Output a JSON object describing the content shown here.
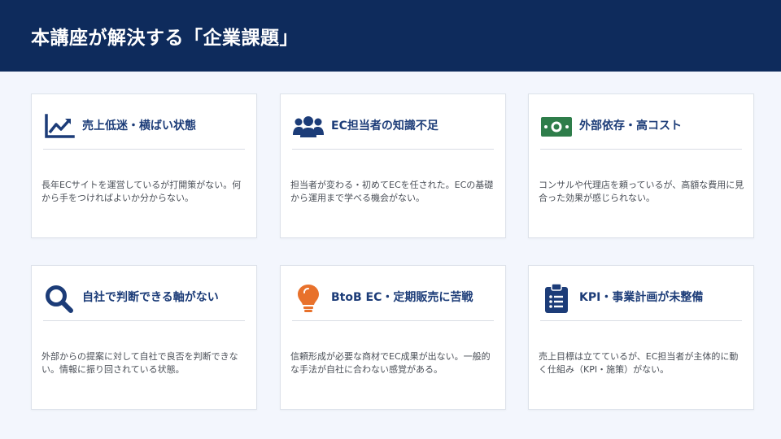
{
  "header": {
    "title": "本講座が解決する「企業課題」"
  },
  "cards": [
    {
      "title": "売上低迷・横ばい状態",
      "desc": "長年ECサイトを運営しているが打開策がない。何から手をつければよいか分からない。",
      "icon": "chart-line-icon"
    },
    {
      "title": "EC担当者の知識不足",
      "desc": "担当者が変わる・初めてECを任された。ECの基礎から運用まで学べる機会がない。",
      "icon": "users-icon"
    },
    {
      "title": "外部依存・高コスト",
      "desc": "コンサルや代理店を頼っているが、高額な費用に見合った効果が感じられない。",
      "icon": "money-bill-icon"
    },
    {
      "title": "自社で判断できる軸がない",
      "desc": "外部からの提案に対して自社で良否を判断できない。情報に振り回されている状態。",
      "icon": "search-icon"
    },
    {
      "title": "BtoB EC・定期販売に苦戦",
      "desc": "信頼形成が必要な商材でEC成果が出ない。一般的な手法が自社に合わない感覚がある。",
      "icon": "lightbulb-icon"
    },
    {
      "title": "KPI・事業計画が未整備",
      "desc": "売上目標は立てているが、EC担当者が主体的に動く仕組み（KPI・施策）がない。",
      "icon": "clipboard-list-icon"
    }
  ],
  "colors": {
    "header_bg": "#0e2b5c",
    "accent_blue": "#1c3c78",
    "money_green": "#2e7d4a",
    "bulb_orange": "#e8712b"
  }
}
